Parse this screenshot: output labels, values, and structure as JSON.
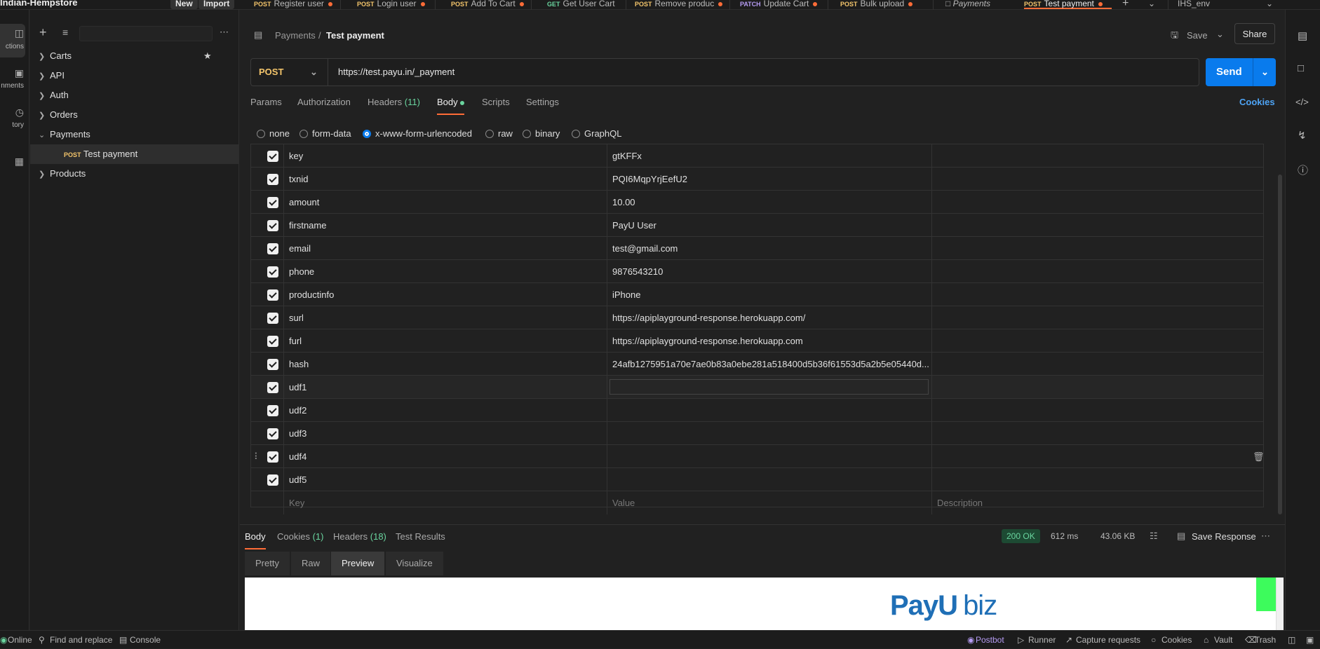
{
  "workspace": {
    "name": "Indian-Hempstore",
    "new_label": "New",
    "import_label": "Import"
  },
  "tabs": [
    {
      "method": "POST",
      "label": "Register user"
    },
    {
      "method": "POST",
      "label": "Login user"
    },
    {
      "method": "POST",
      "label": "Add To Cart"
    },
    {
      "method": "GET",
      "label": "Get User Cart"
    },
    {
      "method": "POST",
      "label": "Remove produc"
    },
    {
      "method": "PATCH",
      "label": "Update Cart"
    },
    {
      "method": "POST",
      "label": "Bulk upload"
    },
    {
      "method": "",
      "label": "Payments"
    },
    {
      "method": "POST",
      "label": "Test payment"
    }
  ],
  "environment": "IHS_env",
  "rail": {
    "collections": "ctions",
    "environments": "nments",
    "history": "tory"
  },
  "sidebar": {
    "items": [
      {
        "label": "Carts"
      },
      {
        "label": "API"
      },
      {
        "label": "Auth"
      },
      {
        "label": "Orders"
      },
      {
        "label": "Payments"
      },
      {
        "label": "Test payment",
        "method": "POST"
      },
      {
        "label": "Products"
      }
    ]
  },
  "breadcrumb": {
    "parent": "Payments",
    "sep": "/",
    "current": "Test payment"
  },
  "actions": {
    "save": "Save",
    "share": "Share",
    "cookies": "Cookies",
    "send": "Send"
  },
  "request": {
    "method": "POST",
    "url": "https://test.payu.in/_payment"
  },
  "request_tabs": {
    "params": "Params",
    "authorization": "Authorization",
    "headers": "Headers",
    "headers_count": "(11)",
    "body": "Body",
    "scripts": "Scripts",
    "settings": "Settings"
  },
  "body_modes": [
    "none",
    "form-data",
    "x-www-form-urlencoded",
    "raw",
    "binary",
    "GraphQL"
  ],
  "body_rows": [
    {
      "key": "key",
      "value": "gtKFFx"
    },
    {
      "key": "txnid",
      "value": "PQI6MqpYrjEefU2"
    },
    {
      "key": "amount",
      "value": "10.00"
    },
    {
      "key": "firstname",
      "value": "PayU User"
    },
    {
      "key": "email",
      "value": "test@gmail.com"
    },
    {
      "key": "phone",
      "value": "9876543210"
    },
    {
      "key": "productinfo",
      "value": "iPhone"
    },
    {
      "key": "surl",
      "value": "https://apiplayground-response.herokuapp.com/"
    },
    {
      "key": "furl",
      "value": "https://apiplayground-response.herokuapp.com"
    },
    {
      "key": "hash",
      "value": "24afb1275951a70e7ae0b83a0ebe281a518400d5b36f61553d5a2b5e05440d..."
    },
    {
      "key": "udf1",
      "value": ""
    },
    {
      "key": "udf2",
      "value": ""
    },
    {
      "key": "udf3",
      "value": ""
    },
    {
      "key": "udf4",
      "value": ""
    },
    {
      "key": "udf5",
      "value": ""
    }
  ],
  "body_placeholders": {
    "key": "Key",
    "value": "Value",
    "description": "Description"
  },
  "response": {
    "tabs": {
      "body": "Body",
      "cookies": "Cookies",
      "cookies_count": "(1)",
      "headers": "Headers",
      "headers_count": "(18)",
      "tests": "Test Results"
    },
    "status": "200 OK",
    "time": "612 ms",
    "size": "43.06 KB",
    "save_response": "Save Response",
    "views": [
      "Pretty",
      "Raw",
      "Preview",
      "Visualize"
    ],
    "preview_logo": {
      "pay": "Pay",
      "u": "U",
      "biz": "biz"
    }
  },
  "statusbar": {
    "online": "Online",
    "find_replace": "Find and replace",
    "console": "Console",
    "postbot": "Postbot",
    "runner": "Runner",
    "capture": "Capture requests",
    "cookies": "Cookies",
    "vault": "Vault",
    "trash": "Trash"
  },
  "colors": {
    "accent": "#097bed",
    "post": "#f4c56b",
    "get": "#6ad59f",
    "patch": "#b59bf2",
    "active_tab": "#ff6c37",
    "ok": "#6ad59f"
  }
}
